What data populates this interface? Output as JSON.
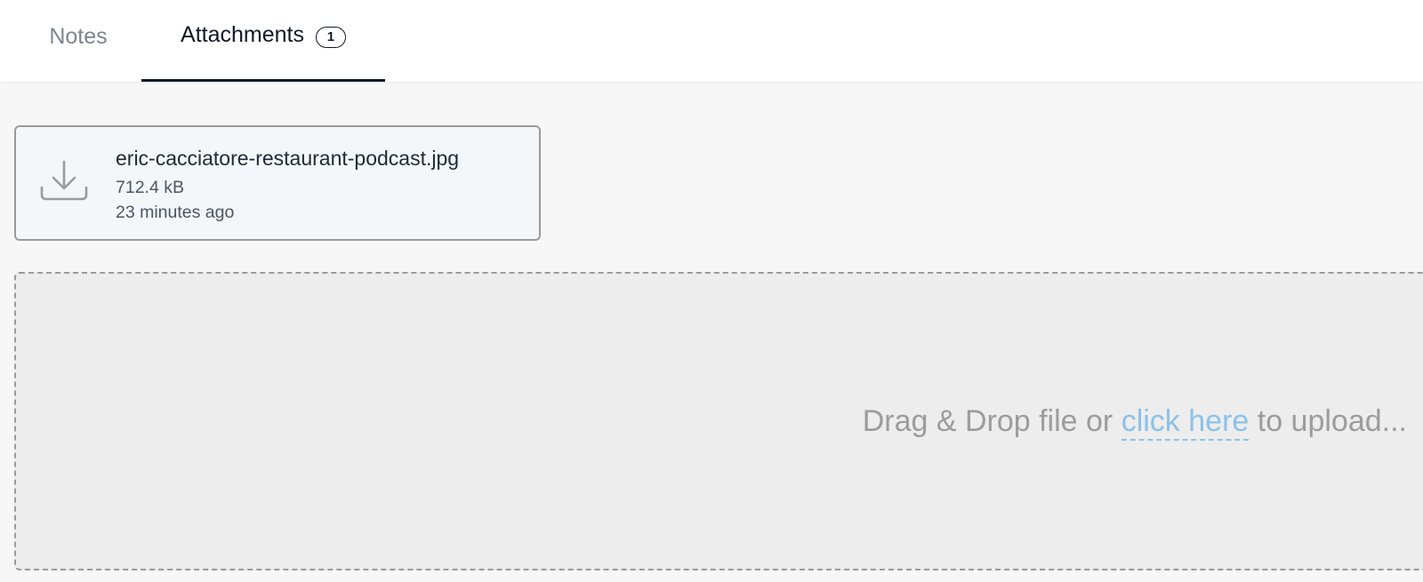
{
  "tabs": {
    "notes_label": "Notes",
    "attachments_label": "Attachments",
    "attachments_count": "1",
    "active": "Attachments"
  },
  "attachment": {
    "file_name": "eric-cacciatore-restaurant-podcast.jpg",
    "file_size": "712.4 kB",
    "uploaded": "23 minutes ago",
    "icon": "download-icon"
  },
  "dropzone": {
    "text_before": "Drag & Drop file or ",
    "link_text": "click here",
    "text_after": " to upload..."
  },
  "colors": {
    "active_tab": "#111827",
    "inactive_tab": "#7c8591",
    "link": "#8cc1e8",
    "dropzone_text": "#9c9c9c"
  }
}
